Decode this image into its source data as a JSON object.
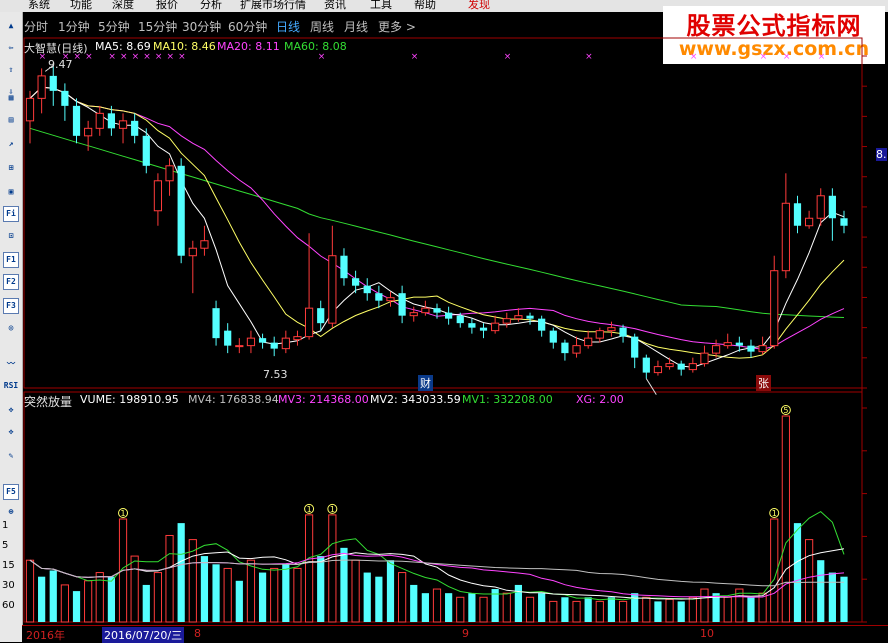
{
  "menu": {
    "items": [
      "系统",
      "功能",
      "深度",
      "报价",
      "分析",
      "扩展市场行情",
      "资讯",
      "工具",
      "帮助",
      "发现"
    ]
  },
  "periods": [
    "分时",
    "1分钟",
    "5分钟",
    "15分钟",
    "30分钟",
    "60分钟",
    "日线",
    "周线",
    "月线",
    "更多 >"
  ],
  "active_period": "日线",
  "logo": {
    "line1": "股票公式指标网",
    "line2": "www.gszx.com.cn"
  },
  "main_legend": {
    "title": "大智慧(日线)",
    "ma5": "MA5: 8.69",
    "ma10": "MA10: 8.46",
    "ma20": "MA20: 8.11",
    "ma60": "MA60: 8.08"
  },
  "annotations": {
    "high_label": "9.47",
    "low_label": "7.53",
    "cai": "财",
    "zhang": "张",
    "right_price": "8."
  },
  "sub_legend": {
    "title": "突然放量",
    "vume": "VUME: 198910.95",
    "mv4": "MV4: 176838.94",
    "mv3": "MV3: 214368.00",
    "mv2": "MV2: 343033.59",
    "mv1": "MV1: 332208.00",
    "xg": "XG: 2.00"
  },
  "left_axis_labels": [
    "1",
    "5",
    "15",
    "30",
    "60"
  ],
  "date_labels": {
    "year": "2016年",
    "selected": "2016/07/20/三",
    "m8": "8",
    "m9": "9",
    "m10": "10"
  },
  "colors": {
    "up": "#ff3b3b",
    "down": "#54ffff",
    "ma5": "#ffffff",
    "ma10": "#ffff66",
    "ma20": "#ff44ff",
    "ma60": "#33dd33",
    "xmark": "#ff44ff"
  },
  "chart_data": {
    "type": "candlestick",
    "candles": [
      [
        9.1,
        9.25,
        8.95,
        9.3
      ],
      [
        9.25,
        9.4,
        9.15,
        9.45
      ],
      [
        9.4,
        9.3,
        9.2,
        9.47
      ],
      [
        9.3,
        9.2,
        9.1,
        9.35
      ],
      [
        9.2,
        9.0,
        8.95,
        9.25
      ],
      [
        9.0,
        9.05,
        8.9,
        9.1
      ],
      [
        9.05,
        9.15,
        9.0,
        9.2
      ],
      [
        9.15,
        9.05,
        9.0,
        9.2
      ],
      [
        9.05,
        9.1,
        8.95,
        9.15
      ],
      [
        9.1,
        9.0,
        8.95,
        9.15
      ],
      [
        9.0,
        8.8,
        8.75,
        9.05
      ],
      [
        8.5,
        8.7,
        8.4,
        8.75
      ],
      [
        8.7,
        8.8,
        8.6,
        8.85
      ],
      [
        8.8,
        8.2,
        8.15,
        8.85
      ],
      [
        8.2,
        8.25,
        7.95,
        8.3
      ],
      [
        8.25,
        8.3,
        8.2,
        8.4
      ],
      [
        7.85,
        7.65,
        7.6,
        7.9
      ],
      [
        7.7,
        7.6,
        7.55,
        7.75
      ],
      [
        7.6,
        7.6,
        7.55,
        7.65
      ],
      [
        7.6,
        7.65,
        7.55,
        7.7
      ],
      [
        7.65,
        7.62,
        7.58,
        7.68
      ],
      [
        7.62,
        7.58,
        7.53,
        7.66
      ],
      [
        7.58,
        7.65,
        7.55,
        7.7
      ],
      [
        7.64,
        7.66,
        7.6,
        7.7
      ],
      [
        7.66,
        7.85,
        7.64,
        8.35
      ],
      [
        7.85,
        7.75,
        7.7,
        7.9
      ],
      [
        7.75,
        8.2,
        7.72,
        8.4
      ],
      [
        8.2,
        8.05,
        8.0,
        8.25
      ],
      [
        8.05,
        8.0,
        7.95,
        8.1
      ],
      [
        8.0,
        7.95,
        7.9,
        8.05
      ],
      [
        7.95,
        7.9,
        7.85,
        8.0
      ],
      [
        7.9,
        7.92,
        7.86,
        7.96
      ],
      [
        7.95,
        7.8,
        7.75,
        8.0
      ],
      [
        7.8,
        7.82,
        7.76,
        7.86
      ],
      [
        7.82,
        7.85,
        7.8,
        7.9
      ],
      [
        7.85,
        7.82,
        7.78,
        7.88
      ],
      [
        7.82,
        7.78,
        7.74,
        7.86
      ],
      [
        7.8,
        7.75,
        7.72,
        7.82
      ],
      [
        7.75,
        7.72,
        7.68,
        7.78
      ],
      [
        7.72,
        7.7,
        7.65,
        7.75
      ],
      [
        7.7,
        7.75,
        7.68,
        7.8
      ],
      [
        7.75,
        7.78,
        7.72,
        7.82
      ],
      [
        7.78,
        7.8,
        7.76,
        7.85
      ],
      [
        7.8,
        7.78,
        7.74,
        7.82
      ],
      [
        7.78,
        7.7,
        7.66,
        7.8
      ],
      [
        7.7,
        7.62,
        7.58,
        7.72
      ],
      [
        7.62,
        7.55,
        7.5,
        7.64
      ],
      [
        7.55,
        7.6,
        7.52,
        7.66
      ],
      [
        7.6,
        7.65,
        7.58,
        7.7
      ],
      [
        7.65,
        7.7,
        7.62,
        7.72
      ],
      [
        7.7,
        7.72,
        7.66,
        7.76
      ],
      [
        7.72,
        7.66,
        7.62,
        7.74
      ],
      [
        7.66,
        7.52,
        7.45,
        7.68
      ],
      [
        7.52,
        7.42,
        7.38,
        7.54
      ],
      [
        7.42,
        7.46,
        7.4,
        7.5
      ],
      [
        7.46,
        7.48,
        7.44,
        7.52
      ],
      [
        7.48,
        7.44,
        7.4,
        7.5
      ],
      [
        7.44,
        7.48,
        7.42,
        7.52
      ],
      [
        7.48,
        7.55,
        7.46,
        7.6
      ],
      [
        7.55,
        7.6,
        7.52,
        7.64
      ],
      [
        7.6,
        7.62,
        7.58,
        7.68
      ],
      [
        7.62,
        7.6,
        7.56,
        7.66
      ],
      [
        7.6,
        7.56,
        7.52,
        7.64
      ],
      [
        7.56,
        7.6,
        7.54,
        7.66
      ],
      [
        7.6,
        8.1,
        7.58,
        8.2
      ],
      [
        8.1,
        8.55,
        8.05,
        8.75
      ],
      [
        8.55,
        8.4,
        8.35,
        8.6
      ],
      [
        8.4,
        8.45,
        8.38,
        8.5
      ],
      [
        8.45,
        8.6,
        8.4,
        8.65
      ],
      [
        8.6,
        8.45,
        8.3,
        8.65
      ],
      [
        8.45,
        8.4,
        8.35,
        8.5
      ]
    ],
    "volume": [
      {
        "v": 0.3,
        "up": true
      },
      {
        "v": 0.22,
        "up": false
      },
      {
        "v": 0.25,
        "up": false
      },
      {
        "v": 0.18,
        "up": true
      },
      {
        "v": 0.15,
        "up": false
      },
      {
        "v": 0.2,
        "up": true
      },
      {
        "v": 0.24,
        "up": true
      },
      {
        "v": 0.22,
        "up": false
      },
      {
        "v": 0.5,
        "up": true
      },
      {
        "v": 0.32,
        "up": true
      },
      {
        "v": 0.18,
        "up": false
      },
      {
        "v": 0.24,
        "up": true
      },
      {
        "v": 0.42,
        "up": true
      },
      {
        "v": 0.48,
        "up": false
      },
      {
        "v": 0.4,
        "up": true
      },
      {
        "v": 0.32,
        "up": false
      },
      {
        "v": 0.28,
        "up": false
      },
      {
        "v": 0.26,
        "up": true
      },
      {
        "v": 0.2,
        "up": false
      },
      {
        "v": 0.3,
        "up": true
      },
      {
        "v": 0.24,
        "up": false
      },
      {
        "v": 0.26,
        "up": true
      },
      {
        "v": 0.28,
        "up": false
      },
      {
        "v": 0.26,
        "up": true
      },
      {
        "v": 0.52,
        "up": true
      },
      {
        "v": 0.32,
        "up": false
      },
      {
        "v": 0.52,
        "up": true
      },
      {
        "v": 0.36,
        "up": false
      },
      {
        "v": 0.3,
        "up": true
      },
      {
        "v": 0.24,
        "up": false
      },
      {
        "v": 0.22,
        "up": false
      },
      {
        "v": 0.3,
        "up": false
      },
      {
        "v": 0.24,
        "up": true
      },
      {
        "v": 0.18,
        "up": false
      },
      {
        "v": 0.14,
        "up": false
      },
      {
        "v": 0.16,
        "up": true
      },
      {
        "v": 0.14,
        "up": false
      },
      {
        "v": 0.12,
        "up": true
      },
      {
        "v": 0.14,
        "up": false
      },
      {
        "v": 0.12,
        "up": true
      },
      {
        "v": 0.16,
        "up": false
      },
      {
        "v": 0.14,
        "up": true
      },
      {
        "v": 0.18,
        "up": false
      },
      {
        "v": 0.12,
        "up": true
      },
      {
        "v": 0.14,
        "up": false
      },
      {
        "v": 0.1,
        "up": true
      },
      {
        "v": 0.12,
        "up": false
      },
      {
        "v": 0.1,
        "up": true
      },
      {
        "v": 0.12,
        "up": false
      },
      {
        "v": 0.1,
        "up": true
      },
      {
        "v": 0.12,
        "up": false
      },
      {
        "v": 0.1,
        "up": true
      },
      {
        "v": 0.14,
        "up": false
      },
      {
        "v": 0.12,
        "up": true
      },
      {
        "v": 0.1,
        "up": false
      },
      {
        "v": 0.11,
        "up": true
      },
      {
        "v": 0.1,
        "up": false
      },
      {
        "v": 0.12,
        "up": true
      },
      {
        "v": 0.16,
        "up": true
      },
      {
        "v": 0.14,
        "up": false
      },
      {
        "v": 0.12,
        "up": true
      },
      {
        "v": 0.16,
        "up": true
      },
      {
        "v": 0.12,
        "up": false
      },
      {
        "v": 0.14,
        "up": true
      },
      {
        "v": 0.5,
        "up": true
      },
      {
        "v": 1.0,
        "up": true
      },
      {
        "v": 0.48,
        "up": false
      },
      {
        "v": 0.4,
        "up": true
      },
      {
        "v": 0.3,
        "up": false
      },
      {
        "v": 0.24,
        "up": false
      },
      {
        "v": 0.22,
        "up": false
      }
    ],
    "x_marks": [
      1,
      3,
      4,
      5,
      7,
      8,
      9,
      10,
      11,
      12,
      13,
      25,
      33,
      41,
      48,
      57,
      63,
      65,
      68
    ]
  }
}
